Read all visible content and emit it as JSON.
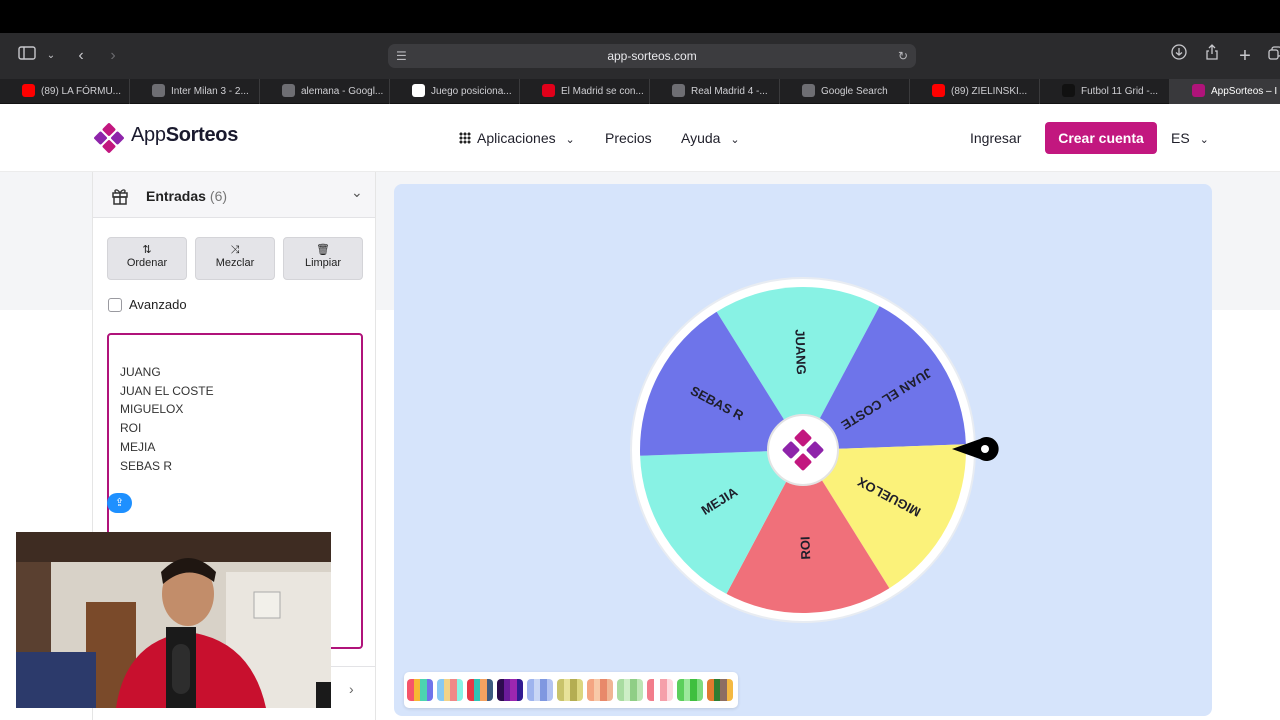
{
  "browser": {
    "url": "app-sorteos.com",
    "tabs": [
      {
        "label": "(89) LA FÓRMU...",
        "icon": "youtube-icon",
        "color": "#ff0000"
      },
      {
        "label": "Inter Milan 3 - 2...",
        "icon": "three-icon",
        "color": "#6e6e73"
      },
      {
        "label": "alemana - Googl...",
        "icon": "google-icon",
        "color": "#6e6e73"
      },
      {
        "label": "Juego posiciona...",
        "icon": "fc-icon",
        "color": "#ffffff"
      },
      {
        "label": "El Madrid se con...",
        "icon": "marca-icon",
        "color": "#e1001a"
      },
      {
        "label": "Real Madrid 4 -...",
        "icon": "three-icon",
        "color": "#6e6e73"
      },
      {
        "label": "Google Search",
        "icon": "google-icon",
        "color": "#6e6e73"
      },
      {
        "label": "(89) ZIELINSKI...",
        "icon": "youtube-icon",
        "color": "#ff0000"
      },
      {
        "label": "Futbol 11 Grid -...",
        "icon": "f11-icon",
        "color": "#111111"
      },
      {
        "label": "AppSorteos – I",
        "icon": "appsorteos-icon",
        "color": "#b0137a"
      }
    ]
  },
  "header": {
    "logo_prefix": "App",
    "logo_suffix": "Sorteos",
    "nav_apps": "Aplicaciones",
    "nav_prices": "Precios",
    "nav_help": "Ayuda",
    "login": "Ingresar",
    "signup": "Crear cuenta",
    "lang": "ES",
    "brand_color": "#c2177f"
  },
  "panel": {
    "title": "Entradas",
    "count": "(6)",
    "btn_sort": "Ordenar",
    "btn_shuffle": "Mezclar",
    "btn_clear": "Limpiar",
    "advanced_label": "Avanzado",
    "entries": [
      "JUANG",
      "JUAN EL COSTE",
      "MIGUELOX",
      "ROI",
      "MEJIA",
      "SEBAS R"
    ]
  },
  "wheel": {
    "segments": [
      {
        "label": "JUANG",
        "color": "#88f2e4"
      },
      {
        "label": "JUAN EL COSTE",
        "color": "#6e74ea"
      },
      {
        "label": "MIGUELOX",
        "color": "#fbf27a"
      },
      {
        "label": "ROI",
        "color": "#f0707a"
      },
      {
        "label": "MEJIA",
        "color": "#88f2e4"
      },
      {
        "label": "SEBAS R",
        "color": "#6e74ea"
      }
    ]
  },
  "palettes": [
    [
      "#f6546a",
      "#f7b733",
      "#4cd6b0",
      "#6e74ea"
    ],
    [
      "#88c9f2",
      "#f2d388",
      "#f08888",
      "#88f2e4"
    ],
    [
      "#e63946",
      "#2ec4b6",
      "#f4a261",
      "#3d5a80"
    ],
    [
      "#2d0b4e",
      "#6a1b9a",
      "#9c27b0",
      "#311b92"
    ],
    [
      "#9fb4ee",
      "#c9d6f5",
      "#7f98e0",
      "#b3c4f1"
    ],
    [
      "#c9c36b",
      "#e8e29a",
      "#b4ad52",
      "#dcd67f"
    ],
    [
      "#f4a582",
      "#f8c9a8",
      "#e8896a",
      "#f0b593"
    ],
    [
      "#a8dca0",
      "#cdeec6",
      "#8fce86",
      "#bde6b5"
    ],
    [
      "#f27d8b",
      "#ffffff",
      "#f5a0aa",
      "#fdd9de"
    ],
    [
      "#5ccf5c",
      "#9de89d",
      "#3fbf3f",
      "#7ddb7d"
    ],
    [
      "#e07a2f",
      "#2e7d32",
      "#8d6e63",
      "#f4b942"
    ]
  ]
}
